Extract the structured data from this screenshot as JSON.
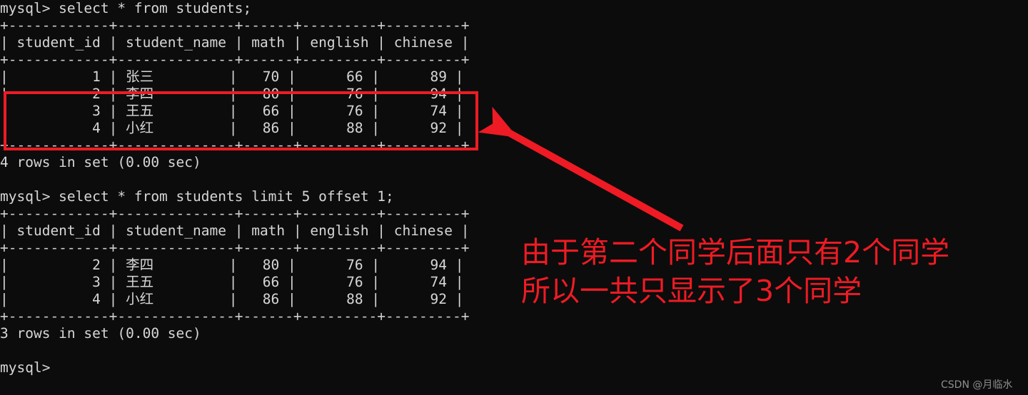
{
  "terminal": {
    "prompt": "mysql>",
    "background_color": "#0c0c0c",
    "text_color": "#d6d6d6",
    "lines": [
      "mysql> select * from students;",
      "+------------+--------------+------+---------+---------+",
      "| student_id | student_name | math | english | chinese |",
      "+------------+--------------+------+---------+---------+",
      "|          1 | 张三         |   70 |      66 |      89 |",
      "|          2 | 李四         |   80 |      76 |      94 |",
      "|          3 | 王五         |   66 |      76 |      74 |",
      "|          4 | 小红         |   86 |      88 |      92 |",
      "+------------+--------------+------+---------+---------+",
      "4 rows in set (0.00 sec)",
      "",
      "mysql> select * from students limit 5 offset 1;",
      "+------------+--------------+------+---------+---------+",
      "| student_id | student_name | math | english | chinese |",
      "+------------+--------------+------+---------+---------+",
      "|          2 | 李四         |   80 |      76 |      94 |",
      "|          3 | 王五         |   66 |      76 |      74 |",
      "|          4 | 小红         |   86 |      88 |      92 |",
      "+------------+--------------+------+---------+---------+",
      "3 rows in set (0.00 sec)",
      "",
      "mysql>"
    ]
  },
  "queries": [
    {
      "sql": "select * from students;",
      "result_status": "4 rows in set (0.00 sec)"
    },
    {
      "sql": "select * from students limit 5 offset 1;",
      "result_status": "3 rows in set (0.00 sec)"
    }
  ],
  "result_tables": [
    {
      "columns": [
        "student_id",
        "student_name",
        "math",
        "english",
        "chinese"
      ],
      "rows": [
        [
          "1",
          "张三",
          "70",
          "66",
          "89"
        ],
        [
          "2",
          "李四",
          "80",
          "76",
          "94"
        ],
        [
          "3",
          "王五",
          "66",
          "76",
          "74"
        ],
        [
          "4",
          "小红",
          "86",
          "88",
          "92"
        ]
      ],
      "row_count_text": "4 rows in set (0.00 sec)"
    },
    {
      "columns": [
        "student_id",
        "student_name",
        "math",
        "english",
        "chinese"
      ],
      "rows": [
        [
          "2",
          "李四",
          "80",
          "76",
          "94"
        ],
        [
          "3",
          "王五",
          "66",
          "76",
          "74"
        ],
        [
          "4",
          "小红",
          "86",
          "88",
          "92"
        ]
      ],
      "row_count_text": "3 rows in set (0.00 sec)"
    }
  ],
  "annotations": {
    "accent_color": "#ee1b24",
    "highlight_box_label": "highlighted-rows-2-3-4",
    "arrow_label": "red-arrow-pointing-to-highlighted-rows",
    "note_line1": "由于第二个同学后面只有2个同学",
    "note_line2": "所以一共只显示了3个同学"
  },
  "watermark": {
    "text": "CSDN @月临水"
  }
}
